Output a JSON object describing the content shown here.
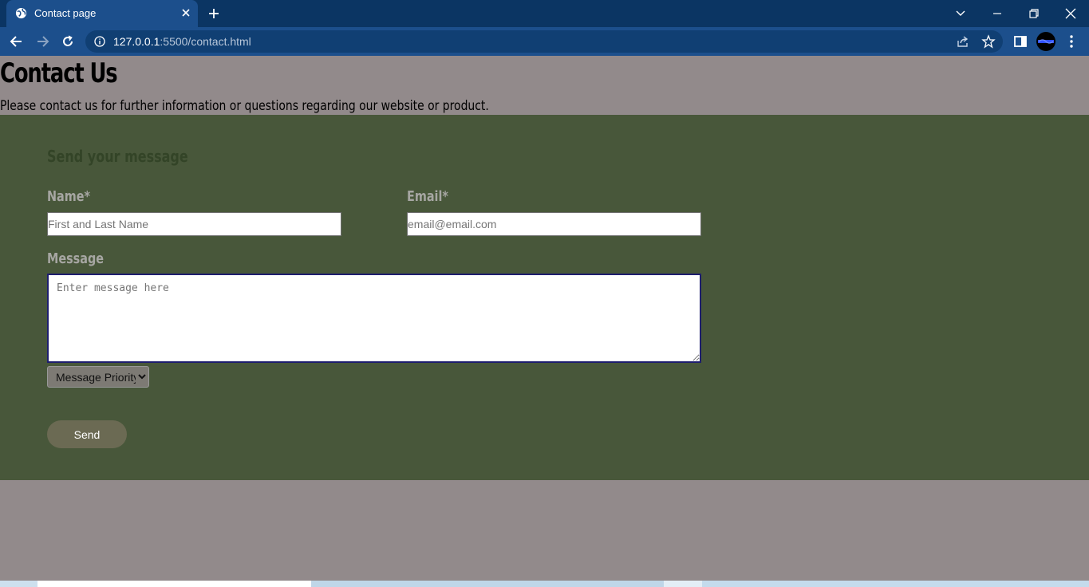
{
  "browser": {
    "tab_title": "Contact page",
    "url_host": "127.0.0.1",
    "url_rest": ":5500/contact.html"
  },
  "page": {
    "heading": "Contact Us",
    "intro": "Please contact us for further information or questions regarding our website or product."
  },
  "form": {
    "heading": "Send your message",
    "name_label": "Name*",
    "name_placeholder": "First and Last Name",
    "email_label": "Email*",
    "email_placeholder": "email@email.com",
    "message_label": "Message",
    "message_placeholder": "Enter message here",
    "priority_selected": "Message Priority",
    "send_label": "Send"
  },
  "colors": {
    "page_bg": "#928a8b",
    "form_bg": "#48573a",
    "chrome_frame": "#0b3563",
    "chrome_toolbar": "#1c4f8c",
    "send_button": "#6b6a53"
  }
}
